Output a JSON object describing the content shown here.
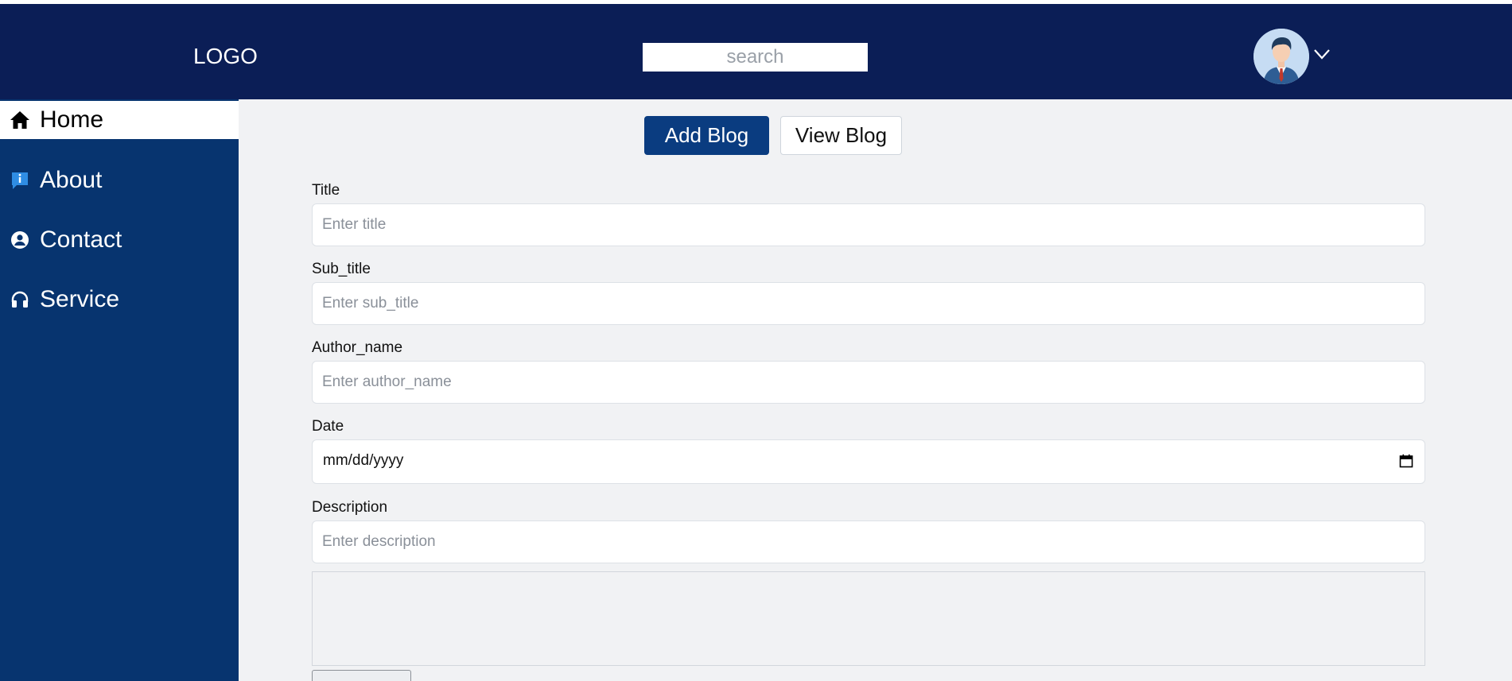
{
  "header": {
    "logo": "LOGO",
    "search_placeholder": "search",
    "avatar_icon": "user-avatar-icon",
    "menu_icon": "chevron-down-icon"
  },
  "sidebar": {
    "items": [
      {
        "label": "Home",
        "icon": "home-icon",
        "active": true
      },
      {
        "label": "About",
        "icon": "info-icon",
        "active": false
      },
      {
        "label": "Contact",
        "icon": "user-circle-icon",
        "active": false
      },
      {
        "label": "Service",
        "icon": "headphones-icon",
        "active": false
      }
    ]
  },
  "main": {
    "add_blog_label": "Add Blog",
    "view_blog_label": "View Blog",
    "form": {
      "title_label": "Title",
      "title_placeholder": "Enter title",
      "subtitle_label": "Sub_title",
      "subtitle_placeholder": "Enter sub_title",
      "author_label": "Author_name",
      "author_placeholder": "Enter author_name",
      "date_label": "Date",
      "date_value": "mm/dd/yyyy",
      "description_label": "Description",
      "description_placeholder": "Enter description"
    }
  },
  "colors": {
    "header_bg": "#0b1e56",
    "sidebar_bg": "#07346f",
    "primary_button": "#0a3c80",
    "main_bg": "#f1f2f4"
  }
}
